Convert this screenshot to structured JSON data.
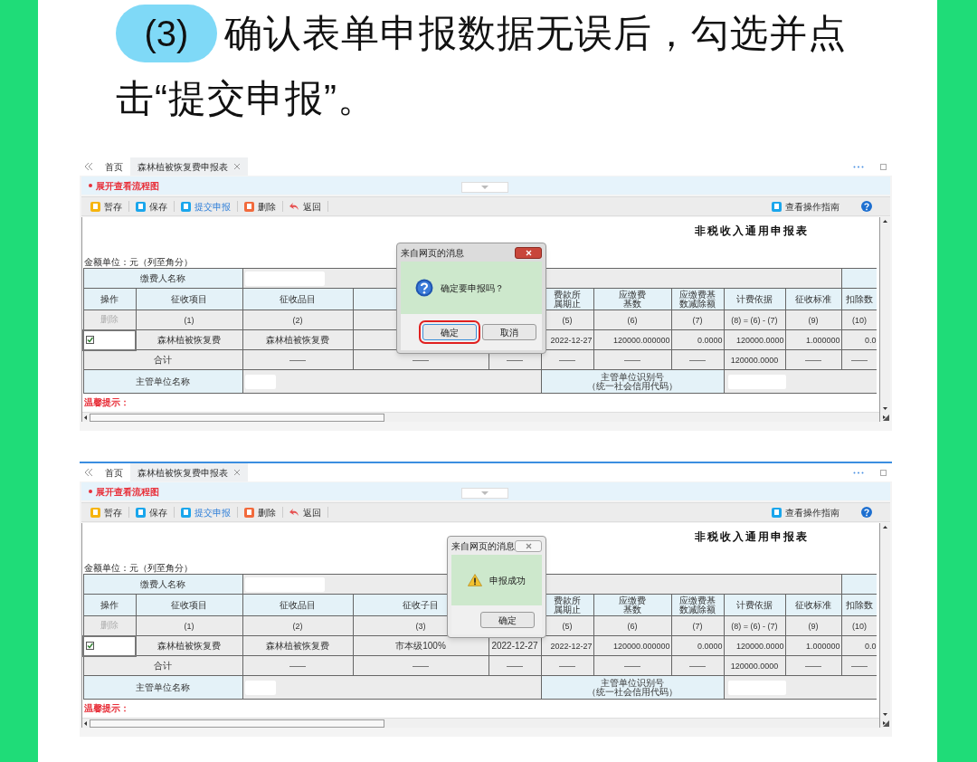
{
  "heading": {
    "step": "(3)",
    "lines": [
      "确认表单申报数据无误后，勾选并点",
      "击“提交申报”。"
    ]
  },
  "screens": [
    {
      "accent_line": false,
      "tabs": [
        {
          "label": "首页",
          "selected": false,
          "closable": false
        },
        {
          "label": "森林植被恢复费申报表",
          "selected": true,
          "closable": true
        }
      ],
      "flow_link": "展开查看流程图",
      "toolbar": [
        {
          "kind": "draft",
          "label": "暂存"
        },
        {
          "kind": "save",
          "label": "保存"
        },
        {
          "kind": "submit",
          "label": "提交申报"
        },
        {
          "kind": "delete",
          "label": "删除"
        },
        {
          "kind": "back",
          "label": "返回"
        }
      ],
      "guide": "查看操作指南",
      "form_title": "非税收入通用申报表",
      "unit_note": "金额单位：元（列至角分）",
      "table": {
        "payer_label": "缴费人名称",
        "columns": [
          "操作",
          "征收项目",
          "征收品目",
          "",
          "",
          "费款所属期止",
          "应缴费基数",
          "应缴费基数减除额",
          "计费依据",
          "征收标准",
          "扣除数"
        ],
        "delete_disabled": true,
        "index_row": {
          "before_dialog": [
            "删除",
            "(1)",
            "(2)"
          ],
          "after_dialog": [
            "(5)",
            "(6)",
            "(7)",
            "(8) = (6) - (7)",
            "(9)",
            "(10)"
          ]
        },
        "rows": [
          {
            "checked": true,
            "cells": [
              "",
              "森林植被恢复费",
              "森林植被恢复费",
              "",
              "",
              "2022-12-27",
              "120000.000000",
              "0.0000",
              "120000.0000",
              "1.000000",
              "0.0"
            ]
          }
        ],
        "total_row": {
          "label": "合计",
          "cells": [
            "——",
            "——",
            "——",
            "——",
            "——",
            "——",
            "120000.0000",
            "——",
            "——"
          ]
        },
        "authority_label": "主管单位名称",
        "authority_id_label": [
          "主管单位识别号",
          "（统一社会信用代码）"
        ]
      },
      "tip": "温馨提示：",
      "dialog": {
        "kind": "question",
        "active": true,
        "title": "来自网页的消息",
        "message": "确定要申报吗？",
        "buttons": [
          {
            "label": "确定",
            "highlighted": true
          },
          {
            "label": "取消",
            "highlighted": false
          }
        ]
      }
    },
    {
      "accent_line": true,
      "tabs": [
        {
          "label": "首页",
          "selected": false,
          "closable": false
        },
        {
          "label": "森林植被恢复费申报表",
          "selected": true,
          "closable": true
        }
      ],
      "flow_link": "展开查看流程图",
      "toolbar": [
        {
          "kind": "draft",
          "label": "暂存"
        },
        {
          "kind": "save",
          "label": "保存"
        },
        {
          "kind": "submit",
          "label": "提交申报"
        },
        {
          "kind": "delete",
          "label": "删除"
        },
        {
          "kind": "back",
          "label": "返回"
        }
      ],
      "guide": "查看操作指南",
      "form_title": "非税收入通用申报表",
      "unit_note": "金额单位：元（列至角分）",
      "table": {
        "payer_label": "缴费人名称",
        "columns": [
          "操作",
          "征收项目",
          "征收品目",
          "征收子目",
          "",
          "费款所属期止",
          "应缴费基数",
          "应缴费基数减除额",
          "计费依据",
          "征收标准",
          "扣除数"
        ],
        "delete_disabled": true,
        "index_row": {
          "before_dialog": [
            "删除",
            "(1)",
            "(2)",
            "(3)"
          ],
          "after_dialog": [
            "(5)",
            "(6)",
            "(7)",
            "(8) = (6) - (7)",
            "(9)",
            "(10)"
          ]
        },
        "rows": [
          {
            "checked": true,
            "cells": [
              "",
              "森林植被恢复费",
              "森林植被恢复费",
              "市本级100%",
              "2022-12-27",
              "2022-12-27",
              "120000.000000",
              "0.0000",
              "120000.0000",
              "1.000000",
              "0.0"
            ]
          }
        ],
        "total_row": {
          "label": "合计",
          "cells": [
            "——",
            "——",
            "——",
            "——",
            "——",
            "——",
            "120000.0000",
            "——",
            "——"
          ]
        },
        "authority_label": "主管单位名称",
        "authority_id_label": [
          "主管单位识别号",
          "（统一社会信用代码）"
        ]
      },
      "tip": "温馨提示：",
      "dialog": {
        "kind": "warning",
        "active": false,
        "title": "来自网页的消息",
        "message": "申报成功",
        "buttons": [
          {
            "label": "确定",
            "highlighted": false
          }
        ]
      }
    }
  ]
}
